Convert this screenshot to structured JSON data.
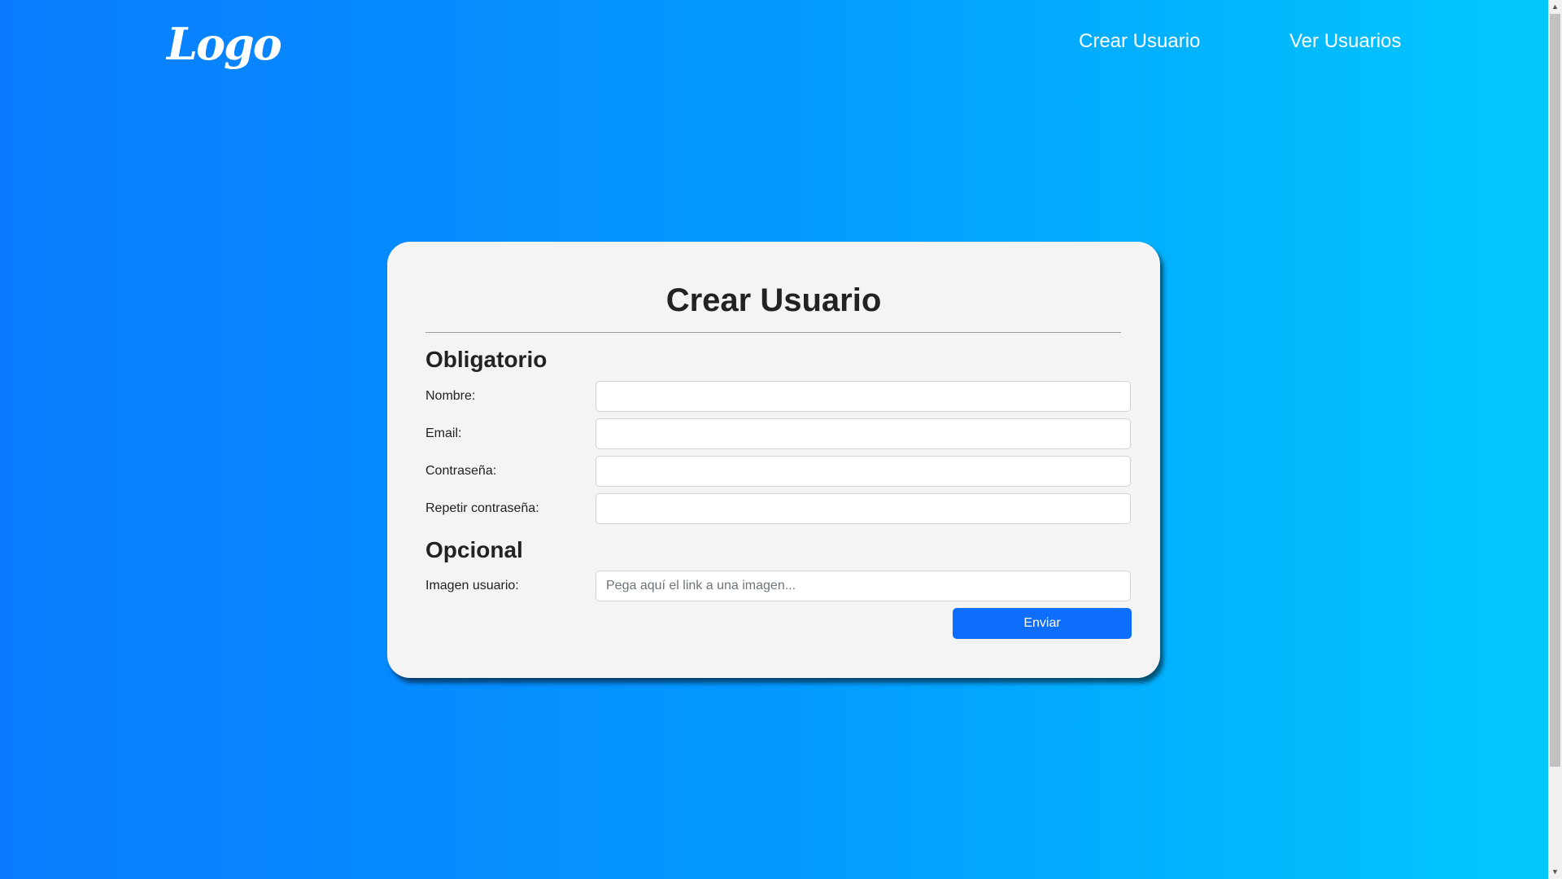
{
  "header": {
    "logo": "Logo",
    "nav": [
      {
        "label": "Crear Usuario"
      },
      {
        "label": "Ver Usuarios"
      }
    ]
  },
  "form": {
    "title": "Crear Usuario",
    "required_section": "Obligatorio",
    "optional_section": "Opcional",
    "fields": [
      {
        "label": "Nombre:",
        "value": "",
        "placeholder": ""
      },
      {
        "label": "Email:",
        "value": "",
        "placeholder": ""
      },
      {
        "label": "Contraseña:",
        "value": "",
        "placeholder": ""
      },
      {
        "label": "Repetir contraseña:",
        "value": "",
        "placeholder": ""
      },
      {
        "label": "Imagen usuario:",
        "value": "",
        "placeholder": "Pega aquí el link a una imagen..."
      }
    ],
    "submit_label": "Enviar"
  },
  "colors": {
    "background_start": "#0a7bff",
    "background_end": "#02c9fd",
    "card": "#f4f4f4",
    "button": "#0d6efd"
  },
  "scrollbar": {
    "up_icon": "scroll-up-arrow",
    "down_icon": "scroll-down-arrow"
  }
}
